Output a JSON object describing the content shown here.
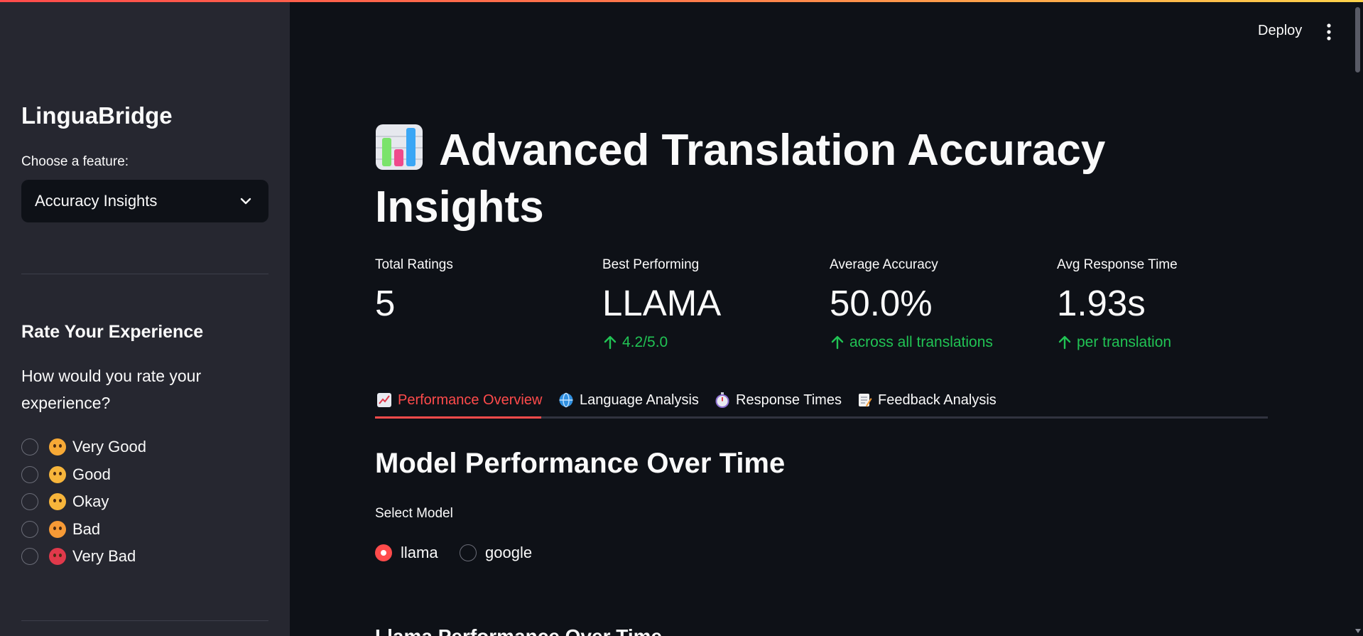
{
  "colors": {
    "background": "#0e1117",
    "sidebar_bg": "#262730",
    "accent": "#ff4b4b",
    "positive": "#21c354",
    "text": "#fafafa"
  },
  "header": {
    "deploy_label": "Deploy",
    "menu_icon": "kebab-menu-icon"
  },
  "sidebar": {
    "title": "LinguaBridge",
    "feature_label": "Choose a feature:",
    "feature_selected": "Accuracy Insights",
    "rate_title": "Rate Your Experience",
    "rate_question": "How would you rate your experience?",
    "ratings": [
      {
        "label": "Very Good",
        "icon": "smiling-face-icon",
        "color": "#f7a936"
      },
      {
        "label": "Good",
        "icon": "slight-smile-face-icon",
        "color": "#f7b53b"
      },
      {
        "label": "Okay",
        "icon": "neutral-face-icon",
        "color": "#f7b53b"
      },
      {
        "label": "Bad",
        "icon": "frowning-face-icon",
        "color": "#f79a36"
      },
      {
        "label": "Very Bad",
        "icon": "angry-face-icon",
        "color": "#e0394b"
      }
    ]
  },
  "main": {
    "title": "Advanced Translation Accuracy Insights",
    "title_icon": "bar-chart-icon",
    "metrics": [
      {
        "label": "Total Ratings",
        "value": "5",
        "delta": ""
      },
      {
        "label": "Best Performing",
        "value": "LLAMA",
        "delta": "4.2/5.0"
      },
      {
        "label": "Average Accuracy",
        "value": "50.0%",
        "delta": "across all translations"
      },
      {
        "label": "Avg Response Time",
        "value": "1.93s",
        "delta": "per translation"
      }
    ],
    "tabs": [
      {
        "label": "Performance Overview",
        "icon": "chart-increasing-icon",
        "active": true
      },
      {
        "label": "Language Analysis",
        "icon": "globe-icon",
        "active": false
      },
      {
        "label": "Response Times",
        "icon": "stopwatch-icon",
        "active": false
      },
      {
        "label": "Feedback Analysis",
        "icon": "memo-icon",
        "active": false
      }
    ],
    "section_title": "Model Performance Over Time",
    "select_model_label": "Select Model",
    "models": [
      {
        "label": "llama",
        "selected": true
      },
      {
        "label": "google",
        "selected": false
      }
    ],
    "subsection_title": "Llama Performance Over Time"
  }
}
